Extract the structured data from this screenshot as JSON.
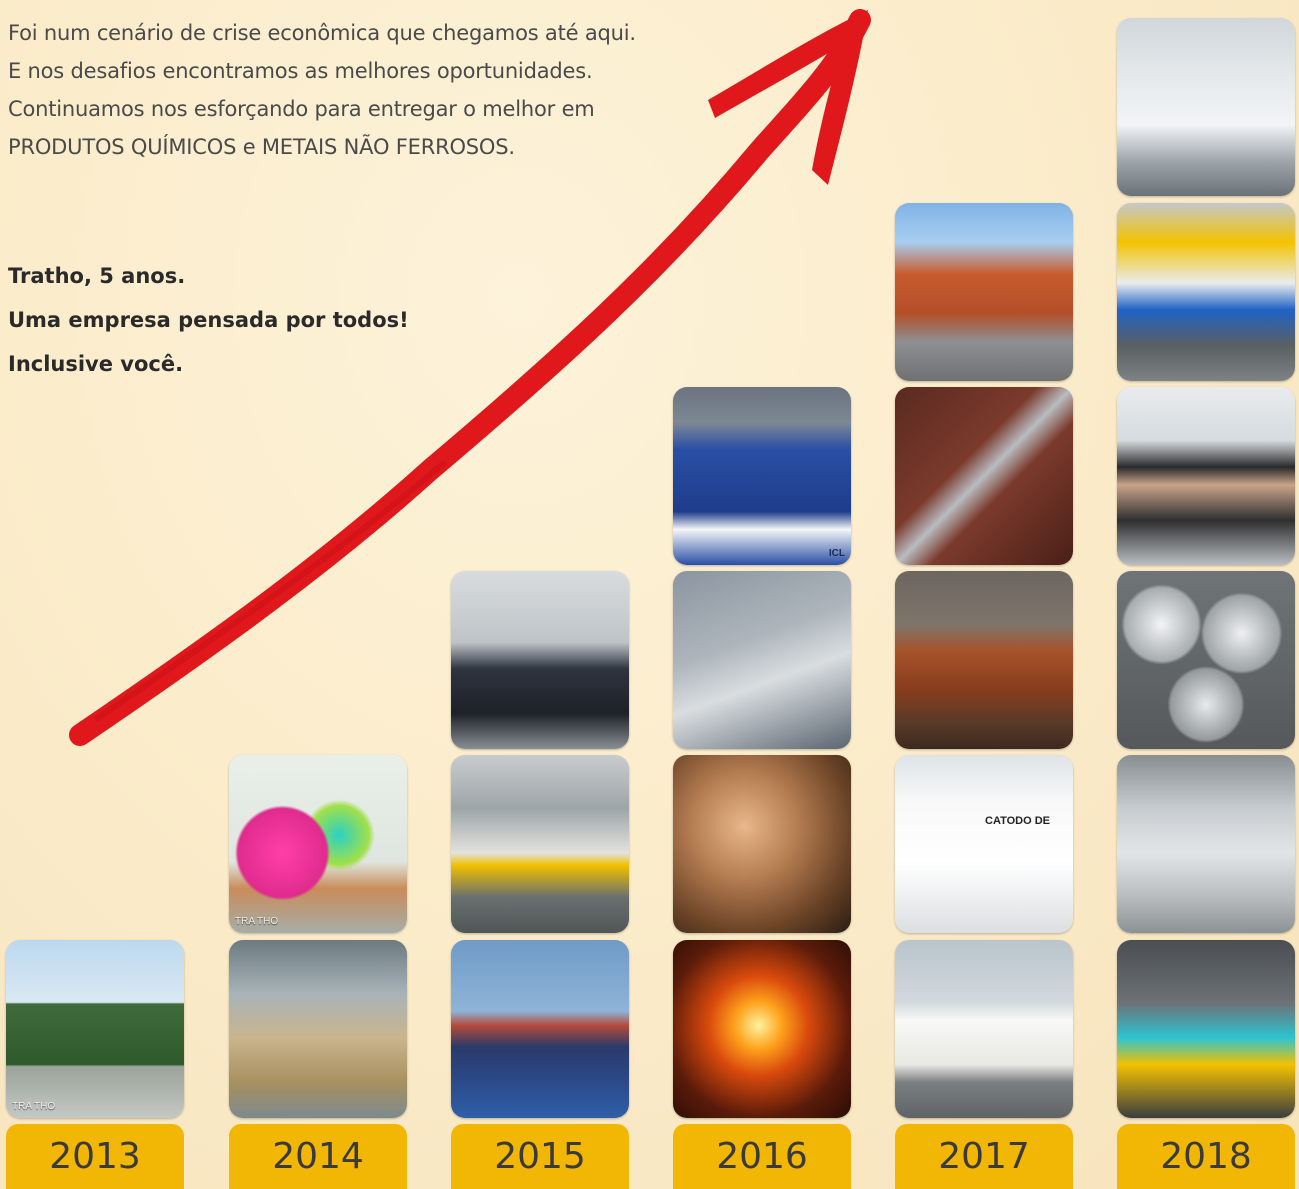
{
  "intro": {
    "lines": [
      "Foi num cenário de crise econômica que chegamos até aqui.",
      "E nos desafios encontramos as melhores oportunidades.",
      "Continuamos nos esforçando para entregar o melhor em",
      "PRODUTOS QUÍMICOS e METAIS NÃO FERROSOS."
    ]
  },
  "tagline": {
    "lines": [
      "Tratho, 5 anos.",
      "Uma empresa pensada por todos!",
      "Inclusive você."
    ]
  },
  "colors": {
    "year_button": "#f2b705",
    "arrow": "#e0181b",
    "text": "#4a4a4a"
  },
  "years": [
    "2013",
    "2014",
    "2015",
    "2016",
    "2017",
    "2018"
  ],
  "photos": {
    "y2013": [
      "truck"
    ],
    "y2014": [
      "metal-ingots-stacks",
      "chemical-flasks"
    ],
    "y2015": [
      "cargo-ship",
      "warehouse-forklift",
      "office-computer"
    ],
    "y2016": [
      "furnace",
      "copper-cylinders",
      "lab-sample",
      "chemical-drums"
    ],
    "y2017": [
      "delivery-trucks",
      "white-buckets",
      "copper-bars",
      "door-handle",
      "building"
    ],
    "y2018": [
      "forklifts",
      "metal-bales",
      "aluminum-spheres",
      "office-team",
      "storage-tanks",
      "lab-worker"
    ]
  },
  "photo_text": {
    "flask_label": "TRA THO",
    "drum_label": "ICL",
    "bucket_label": "CATODO DE",
    "truck_brand": "TRA THO"
  }
}
